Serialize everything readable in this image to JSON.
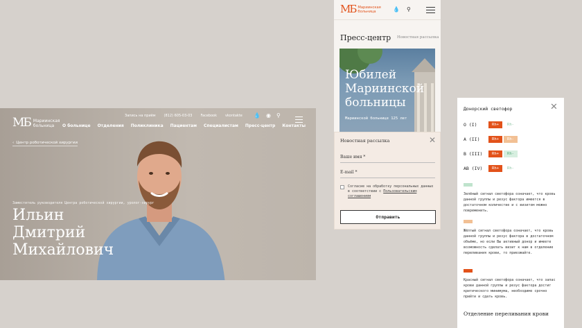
{
  "hero": {
    "logo_text": "Мариинская\nбольница",
    "top_links": [
      "Запись на приём",
      "(812) 605-03-03",
      "Facebook",
      "vkontakte"
    ],
    "nav": [
      "О больнице",
      "Отделения",
      "Поликлиника",
      "Пациентам",
      "Специалистам",
      "Пресс-центр",
      "Контакты"
    ],
    "breadcrumb": "Центр роботической хирургии",
    "role": "Заместитель руководителя Центра роботической хирургии, уролог-хирург",
    "name_lines": [
      "Ильин",
      "Дмитрий",
      "Михайлович"
    ]
  },
  "press": {
    "logo_text": "Мариинская\nбольница",
    "title": "Пресс-центр",
    "link": "Новостная рассылка",
    "photo_title": "Юбилей\nМариинской\nбольницы",
    "photo_sub": "Мариинской больнице 125 лет"
  },
  "newsletter": {
    "title": "Новостная рассылка",
    "name_label": "Ваше имя *",
    "email_label": "E-mail *",
    "consent_text": "Согласие на обработку персональных данных в соответствии с ",
    "consent_link": "Пользовательским соглашением",
    "submit_label": "Отправить"
  },
  "donor": {
    "title": "Донорский светофор",
    "rows": [
      {
        "group": "O (I)",
        "plus": "Rh+",
        "plus_color": "red",
        "minus": "Rh-",
        "minus_color": "green"
      },
      {
        "group": "A (II)",
        "plus": "Rh+",
        "plus_color": "red",
        "minus": "Rh-",
        "minus_color": "yellow"
      },
      {
        "group": "B (III)",
        "plus": "Rh+",
        "plus_color": "red",
        "minus": "Rh-",
        "minus_color": "greenbg"
      },
      {
        "group": "AB (IV)",
        "plus": "Rh+",
        "plus_color": "red",
        "minus": "Rh-",
        "minus_color": "green"
      }
    ],
    "green_text": "Зелёный сигнал светофора означает, что кровь данной группы и резус фактора имеется в достаточном количестве и с визитом можно повременить.",
    "yellow_text": "Жёлтый сигнал светофора означает, что кровь данной группы и резус фактора в достаточном объёме, но если Вы активный донор и имеете возможность сделать визит к нам в отделение переливания крови, то приезжайте.",
    "red_text": "Красный сигнал светофора означает, что запас крови данной группы и резус фактора достиг критического минимума, необходимо срочно прийти и сдать кровь.",
    "footer_title": "Отделение переливания крови"
  },
  "colors": {
    "accent": "#e2521a",
    "yellow": "#f2c094",
    "green": "#8fc7a6"
  }
}
